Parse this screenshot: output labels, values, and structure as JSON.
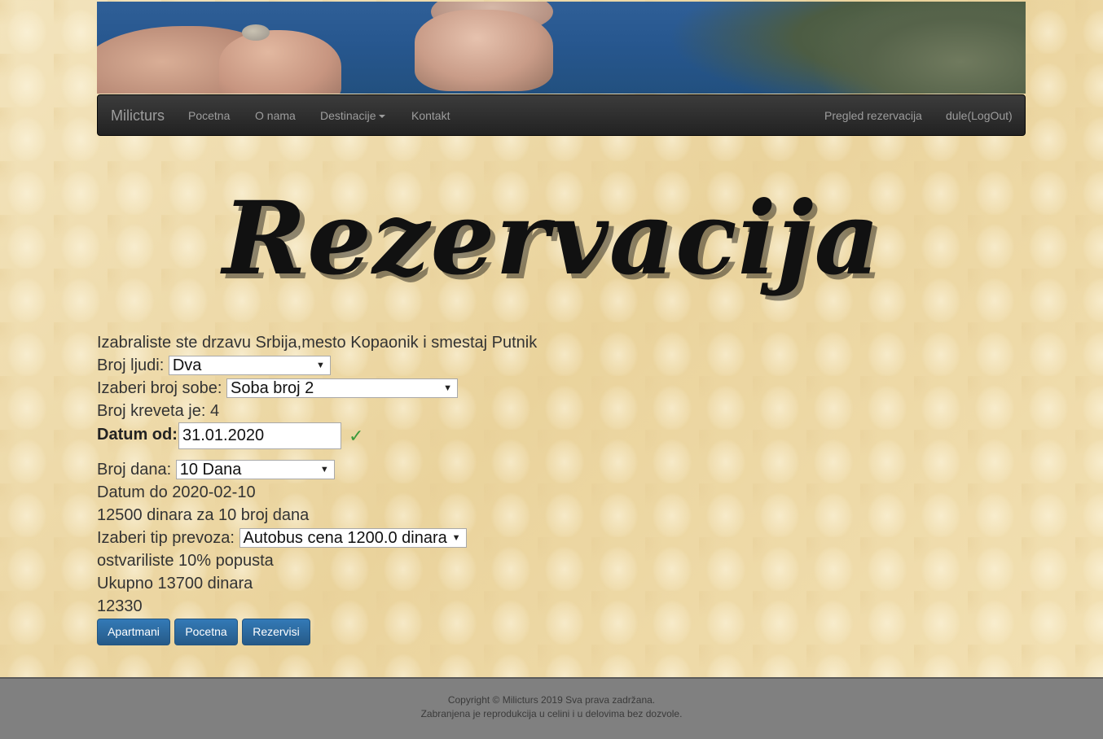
{
  "navbar": {
    "brand": "Milicturs",
    "links": [
      "Pocetna",
      "O nama",
      "Destinacije",
      "Kontakt"
    ],
    "right_links": [
      "Pregled rezervacija",
      "dule(LogOut)"
    ]
  },
  "page_title": "Rezervacija",
  "form": {
    "intro": "Izabraliste ste drzavu Srbija,mesto Kopaonik i smestaj Putnik",
    "people_label": "Broj ljudi:",
    "people_value": "Dva",
    "room_label": "Izaberi broj sobe:",
    "room_value": "Soba broj 2",
    "beds_text": "Broj kreveta je: 4",
    "date_from_label": "Datum od:",
    "date_from_value": "31.01.2020",
    "date_valid_icon": "checkmark-icon",
    "days_label": "Broj dana:",
    "days_value": "10 Dana",
    "date_to_text": "Datum do 2020-02-10",
    "price_text": "12500 dinara za 10 broj dana",
    "transport_label": "Izaberi tip prevoza:",
    "transport_value": "Autobus cena 1200.0 dinara",
    "discount_text": "ostvariliste 10% popusta",
    "total_text": "Ukupno 13700 dinara",
    "final_amount": "12330"
  },
  "buttons": {
    "apartmani": "Apartmani",
    "pocetna": "Pocetna",
    "rezervisi": "Rezervisi"
  },
  "footer": {
    "line1": "Copyright © Milicturs 2019 Sva prava zadržana.",
    "line2": "Zabranjena je reprodukcija u celini i u delovima bez dozvole."
  },
  "colors": {
    "navbar_bg": "#222222",
    "button_primary": "#337ab7",
    "valid_check": "#3c9a3c",
    "footer_bg": "#808080"
  }
}
